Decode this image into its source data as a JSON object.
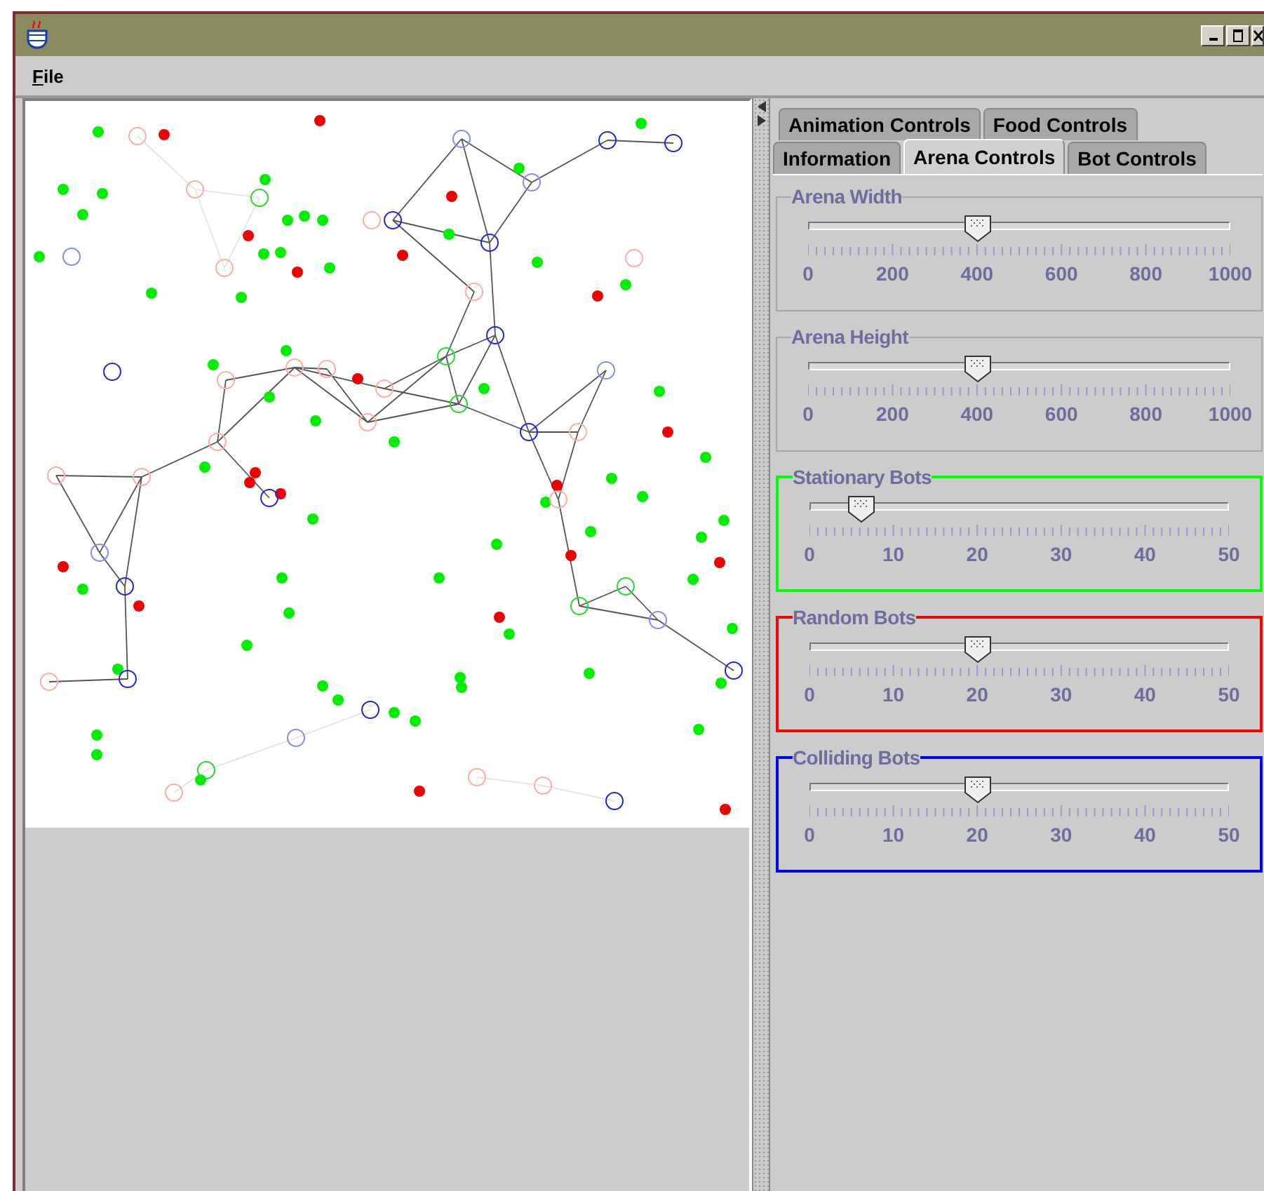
{
  "menu": [
    {
      "label": "File"
    }
  ],
  "tab_rows": [
    {
      "tabs": [
        {
          "label": "Animation Controls",
          "selected": false
        },
        {
          "label": "Food Controls",
          "selected": false
        }
      ]
    },
    {
      "tabs": [
        {
          "label": "Information",
          "selected": false
        },
        {
          "label": "Arena Controls",
          "selected": true
        },
        {
          "label": "Bot Controls",
          "selected": false
        }
      ]
    }
  ],
  "sliders": [
    {
      "title": "Arena Width",
      "color": "#a8a8a8",
      "level": 0.4,
      "tick_labels": [
        "0",
        "200",
        "400",
        "600",
        "800",
        "1000"
      ]
    },
    {
      "title": "Arena Height",
      "color": "#a8a8a8",
      "level": 0.4,
      "tick_labels": [
        "0",
        "200",
        "400",
        "600",
        "800",
        "1000"
      ]
    },
    {
      "title": "Stationary Bots",
      "color": "#00ff00",
      "level": 0.12,
      "tick_labels": [
        "0",
        "10",
        "20",
        "30",
        "40",
        "50"
      ]
    },
    {
      "title": "Random Bots",
      "color": "#ff0000",
      "level": 0.4,
      "tick_labels": [
        "0",
        "10",
        "20",
        "30",
        "40",
        "50"
      ]
    },
    {
      "title": "Colliding Bots",
      "color": "#0000ff",
      "level": 0.4,
      "tick_labels": [
        "0",
        "10",
        "20",
        "30",
        "40",
        "50"
      ]
    }
  ]
}
